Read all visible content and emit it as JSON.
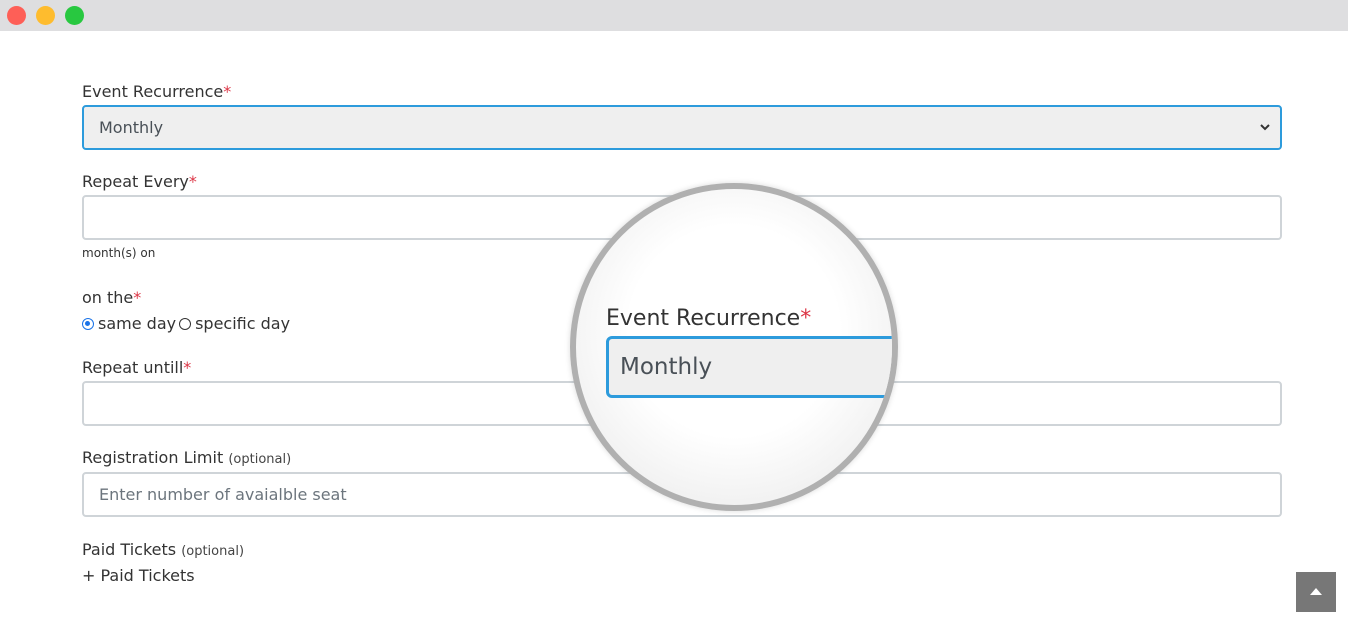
{
  "window": {
    "controls": [
      "close",
      "minimize",
      "maximize"
    ]
  },
  "form": {
    "recurrence": {
      "label": "Event Recurrence",
      "required_mark": "*",
      "value": "Monthly"
    },
    "repeat_every": {
      "label": "Repeat Every",
      "required_mark": "*",
      "value": "",
      "hint": "month(s) on"
    },
    "on_the": {
      "label": "on the",
      "required_mark": "*",
      "options": [
        {
          "label": "same day",
          "checked": true
        },
        {
          "label": "specific day",
          "checked": false
        }
      ]
    },
    "repeat_until": {
      "label": "Repeat untill",
      "required_mark": "*",
      "value": ""
    },
    "registration_limit": {
      "label": "Registration Limit",
      "optional": "(optional)",
      "placeholder": "Enter number of avaialble seat"
    },
    "paid_tickets": {
      "label": "Paid Tickets",
      "optional": "(optional)",
      "add_link": "+ Paid Tickets"
    }
  },
  "magnifier": {
    "label": "Event Recurrence",
    "required_mark": "*",
    "value": "Monthly"
  },
  "colors": {
    "accent": "#2d9bdc",
    "required": "#dc3545",
    "select_bg": "#efefef",
    "titlebar": "#dedee0"
  },
  "icons": {
    "scroll_top": "chevron-up-icon",
    "select_arrow": "chevron-down-icon"
  }
}
